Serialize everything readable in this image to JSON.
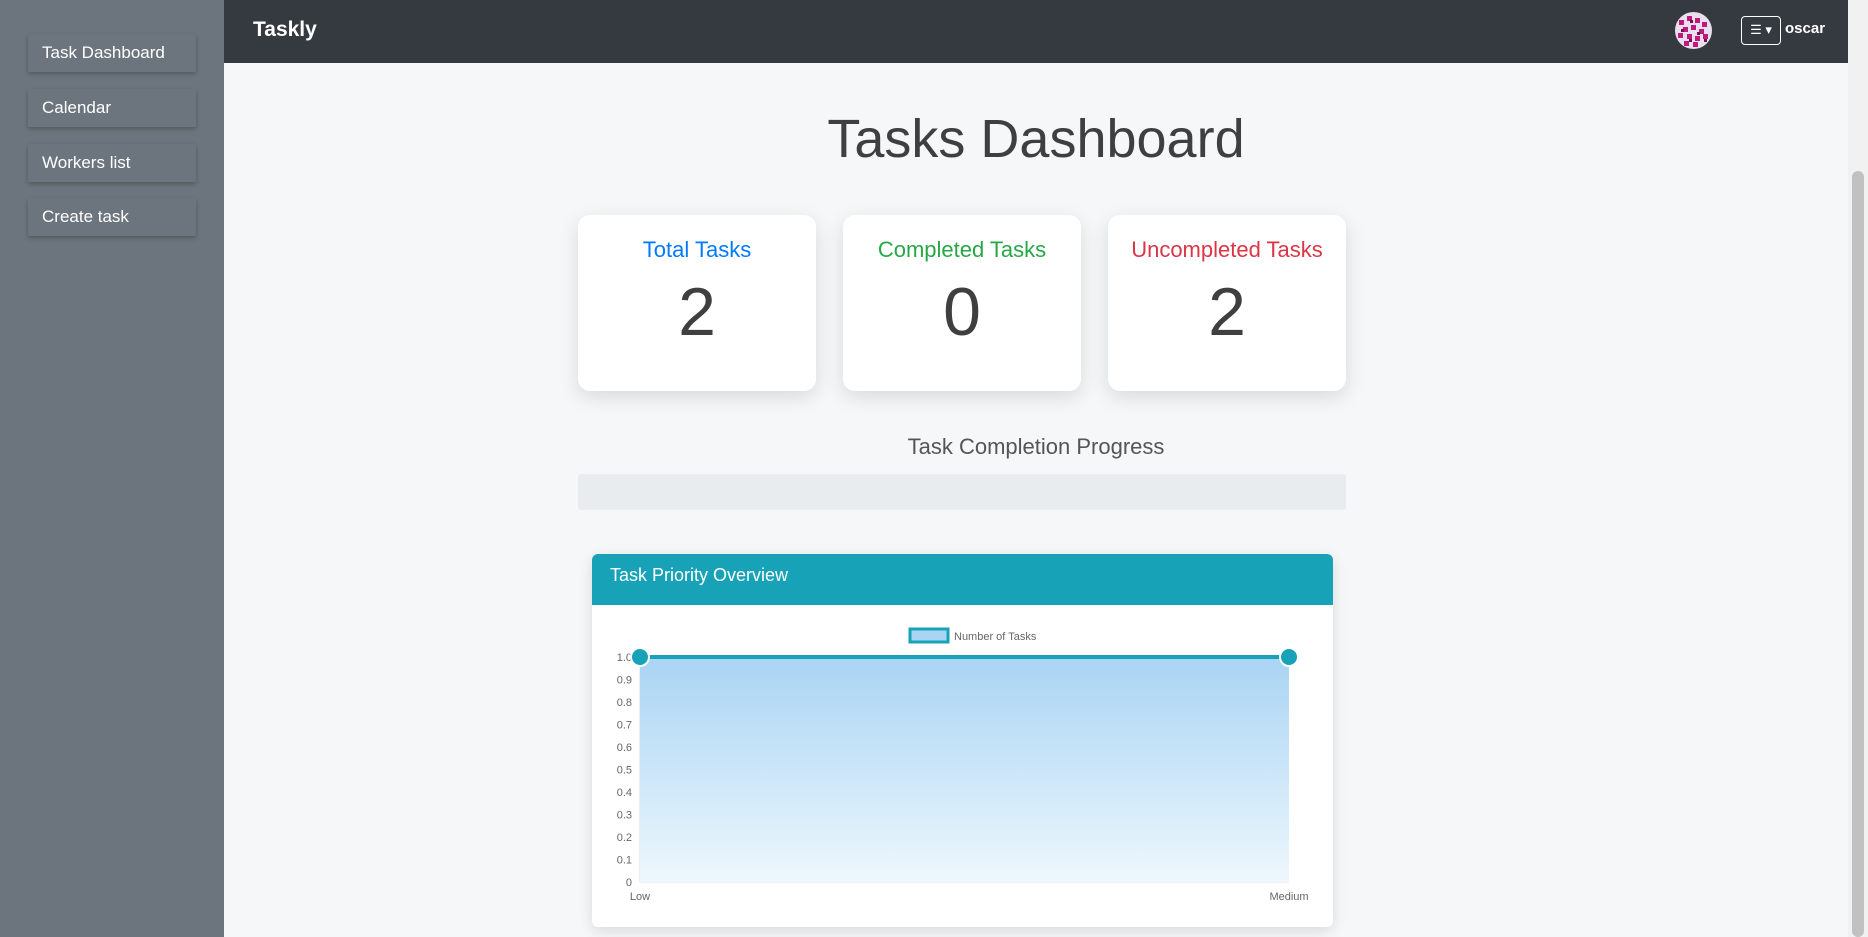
{
  "sidebar": {
    "items": [
      {
        "label": "Task Dashboard"
      },
      {
        "label": "Calendar"
      },
      {
        "label": "Workers list"
      },
      {
        "label": "Create task"
      }
    ]
  },
  "topbar": {
    "brand": "Taskly",
    "menu_icon": "☰ ▾",
    "username": "oscar"
  },
  "page": {
    "title": "Tasks Dashboard"
  },
  "stats": {
    "total_label": "Total Tasks",
    "total_value": "2",
    "completed_label": "Completed Tasks",
    "completed_value": "0",
    "uncompleted_label": "Uncompleted Tasks",
    "uncompleted_value": "2"
  },
  "progress": {
    "title": "Task Completion Progress",
    "percent": 0
  },
  "chart_card": {
    "title": "Task Priority Overview"
  },
  "colors": {
    "total": "#007bff",
    "completed": "#28a745",
    "uncompleted": "#dc3545",
    "accent": "#17a2b8"
  },
  "chart_data": {
    "type": "area",
    "categories": [
      "Low",
      "Medium"
    ],
    "series": [
      {
        "name": "Number of Tasks",
        "values": [
          1,
          1
        ]
      }
    ],
    "ylim": [
      0,
      1
    ],
    "yticks": [
      "0",
      "0.1",
      "0.2",
      "0.3",
      "0.4",
      "0.5",
      "0.6",
      "0.7",
      "0.8",
      "0.9",
      "1.0"
    ],
    "legend": "top",
    "grid": true
  }
}
